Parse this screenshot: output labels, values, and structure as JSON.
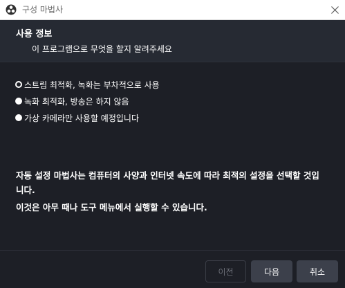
{
  "window": {
    "title": "구성 마법사",
    "icon": "obs-logo-icon",
    "close_icon": "close-icon"
  },
  "header": {
    "title": "사용 정보",
    "subtitle": "이 프로그램으로 무엇을 할지 알려주세요"
  },
  "options": [
    {
      "label": "스트림 최적화, 녹화는 부차적으로 사용",
      "checked": true
    },
    {
      "label": "녹화 최적화, 방송은 하지 않음",
      "checked": false
    },
    {
      "label": "가상 카메라만 사용할 예정입니다",
      "checked": false
    }
  ],
  "info": {
    "line1": "자동 설정 마법사는 컴퓨터의 사양과 인터넷 속도에 따라 최적의 설정을 선택할 것입니다.",
    "line2": "이것은 아무 때나 도구 메뉴에서 실행할 수 있습니다."
  },
  "buttons": {
    "prev": "이전",
    "next": "다음",
    "cancel": "취소"
  }
}
